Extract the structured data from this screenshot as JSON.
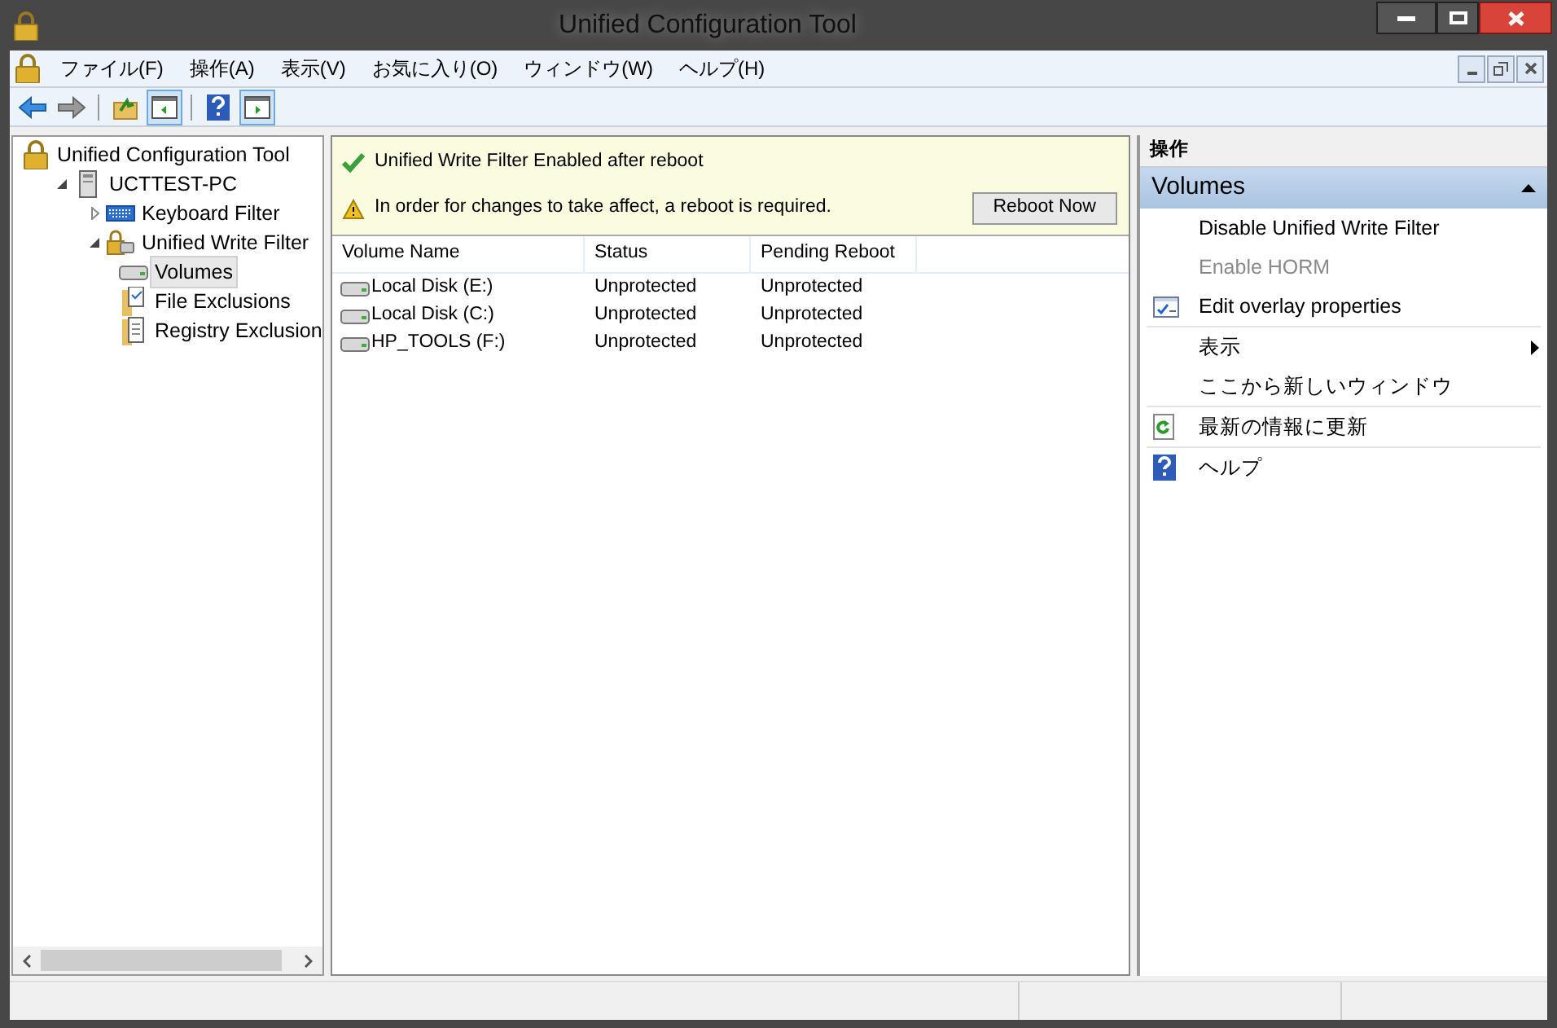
{
  "window": {
    "title": "Unified Configuration Tool"
  },
  "menu": [
    {
      "label": "ファイル(F)"
    },
    {
      "label": "操作(A)"
    },
    {
      "label": "表示(V)"
    },
    {
      "label": "お気に入り(O)"
    },
    {
      "label": "ウィンドウ(W)"
    },
    {
      "label": "ヘルプ(H)"
    }
  ],
  "toolbar": [
    {
      "kind": "back",
      "on": false
    },
    {
      "kind": "forward",
      "on": false
    },
    {
      "kind": "sep"
    },
    {
      "kind": "up",
      "on": false
    },
    {
      "kind": "tree",
      "on": true
    },
    {
      "kind": "sep"
    },
    {
      "kind": "help",
      "on": false
    },
    {
      "kind": "actions",
      "on": true
    }
  ],
  "tree": [
    {
      "label": "Unified Configuration Tool",
      "kind": "lock",
      "selected": false,
      "children": [
        {
          "label": "UCTTEST-PC",
          "kind": "computer",
          "selected": false,
          "expanded": true,
          "children": [
            {
              "label": "Keyboard Filter",
              "kind": "keyboard",
              "selected": false,
              "expanded": false
            },
            {
              "label": "Unified Write Filter",
              "kind": "filter",
              "selected": false,
              "expanded": true,
              "children": [
                {
                  "label": "Volumes",
                  "kind": "drive",
                  "selected": true
                },
                {
                  "label": "File Exclusions",
                  "kind": "files",
                  "selected": false
                },
                {
                  "label": "Registry Exclusion",
                  "kind": "registry",
                  "selected": false
                }
              ]
            }
          ]
        }
      ]
    }
  ],
  "notices": [
    {
      "kind": "ok",
      "text": "Unified Write Filter Enabled after reboot"
    },
    {
      "kind": "warning",
      "text": "In order for changes to take affect, a reboot is required.",
      "button": "Reboot Now"
    }
  ],
  "table": {
    "columns": [
      "Volume Name",
      "Status",
      "Pending Reboot"
    ],
    "rows": [
      [
        "Local Disk (E:)",
        "Unprotected",
        "Unprotected"
      ],
      [
        "Local Disk (C:)",
        "Unprotected",
        "Unprotected"
      ],
      [
        "HP_TOOLS (F:)",
        "Unprotected",
        "Unprotected"
      ]
    ]
  },
  "actions": {
    "header": "操作",
    "section": {
      "title": "Volumes",
      "expanded": true
    },
    "groups": [
      [
        {
          "label": "Disable Unified Write Filter",
          "kind": "plain",
          "disabled": false,
          "submenu": false
        },
        {
          "label": "Enable HORM",
          "kind": "plain",
          "disabled": true,
          "submenu": false
        },
        {
          "label": "Edit overlay properties",
          "kind": "properties",
          "disabled": false,
          "submenu": false
        }
      ],
      [
        {
          "label": "表示",
          "kind": "plain",
          "disabled": false,
          "submenu": true
        },
        {
          "label": "ここから新しいウィンドウ",
          "kind": "plain",
          "disabled": false,
          "submenu": false
        }
      ],
      [
        {
          "label": "最新の情報に更新",
          "kind": "refresh",
          "disabled": false,
          "submenu": false
        }
      ],
      [
        {
          "label": "ヘルプ",
          "kind": "help",
          "disabled": false,
          "submenu": false
        }
      ]
    ]
  }
}
